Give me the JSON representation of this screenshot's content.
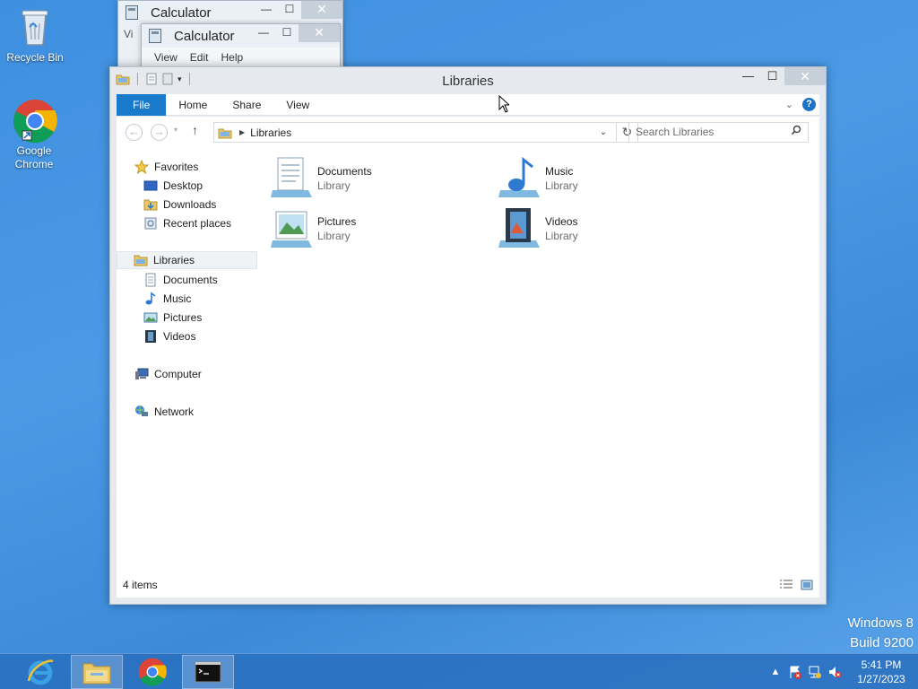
{
  "desktop": {
    "icons": [
      {
        "label": "Recycle Bin"
      },
      {
        "label_line1": "Google",
        "label_line2": "Chrome"
      }
    ],
    "watermark": {
      "line1": "Windows 8",
      "line2": "Build 9200"
    }
  },
  "calc_back": {
    "title": "Calculator",
    "menu_fragment": "Vi"
  },
  "calc_front": {
    "title": "Calculator",
    "menu": [
      "View",
      "Edit",
      "Help"
    ]
  },
  "explorer": {
    "title": "Libraries",
    "ribbon_tabs": [
      "File",
      "Home",
      "Share",
      "View"
    ],
    "address": "Libraries",
    "search_placeholder": "Search Libraries",
    "nav": {
      "favorites": "Favorites",
      "favorites_items": [
        "Desktop",
        "Downloads",
        "Recent places"
      ],
      "libraries": "Libraries",
      "libraries_items": [
        "Documents",
        "Music",
        "Pictures",
        "Videos"
      ],
      "computer": "Computer",
      "network": "Network"
    },
    "tiles": [
      {
        "name": "Documents",
        "sub": "Library"
      },
      {
        "name": "Music",
        "sub": "Library"
      },
      {
        "name": "Pictures",
        "sub": "Library"
      },
      {
        "name": "Videos",
        "sub": "Library"
      }
    ],
    "status": "4 items"
  },
  "taskbar": {
    "clock_time": "5:41 PM",
    "clock_date": "1/27/2023"
  },
  "colors": {
    "accent": "#1979ca",
    "desktop": "#4a9ae6",
    "taskbar": "#286ebe"
  }
}
